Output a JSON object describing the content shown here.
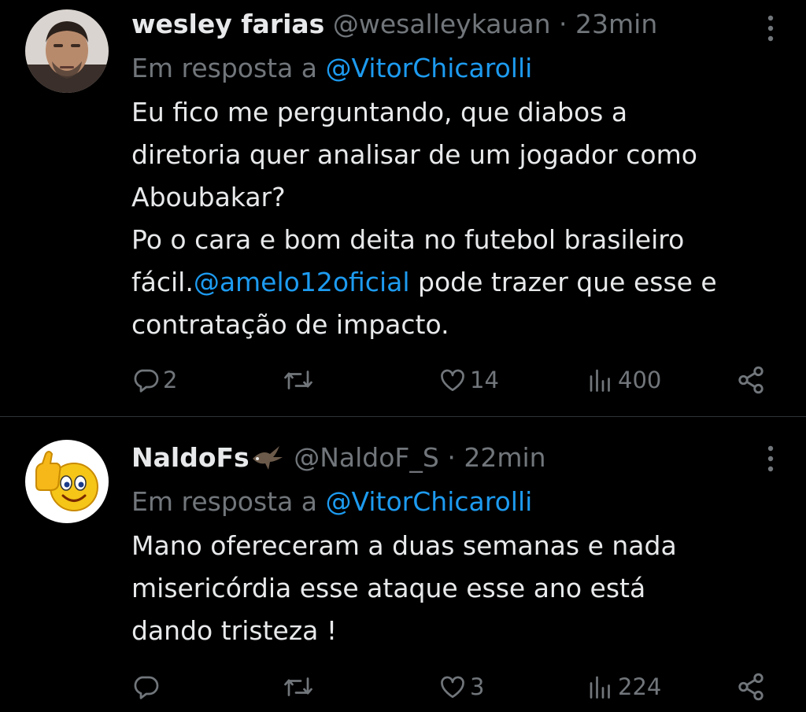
{
  "tweets": [
    {
      "display_name": "wesley farias",
      "handle": "@wesalleykauan",
      "separator": "·",
      "time": "23min",
      "reply_prefix": "Em resposta a",
      "reply_mention": "@VitorChicarolli",
      "text_lines": [
        "Eu fico me perguntando, que diabos a",
        "diretoria quer analisar de um jogador como",
        "Aboubakar?",
        "Po o cara e bom deita no futebol brasileiro"
      ],
      "text_line5_prefix": "fácil.",
      "text_mention": "@amelo12oficial",
      "text_line5_suffix": " pode trazer que esse e",
      "text_line6": "contratação de impacto.",
      "replies": "2",
      "retweets": "",
      "likes": "14",
      "views": "400",
      "avatar_icon": "user-photo-avatar"
    },
    {
      "display_name": "NaldoFs",
      "badge_icon": "eagle-emoji-icon",
      "handle": "@NaldoF_S",
      "separator": "·",
      "time": "22min",
      "reply_prefix": "Em resposta a",
      "reply_mention": "@VitorChicarolli",
      "text_lines": [
        "Mano ofereceram a duas semanas e nada",
        "misericórdia esse ataque esse ano está",
        "dando tristeza !"
      ],
      "replies": "",
      "retweets": "",
      "likes": "3",
      "views": "224",
      "avatar_icon": "thumbs-up-smiley-avatar"
    }
  ],
  "colors": {
    "background": "#000000",
    "text": "#e7e9ea",
    "muted": "#71767b",
    "link": "#1d9bf0",
    "divider": "#2f3336"
  }
}
